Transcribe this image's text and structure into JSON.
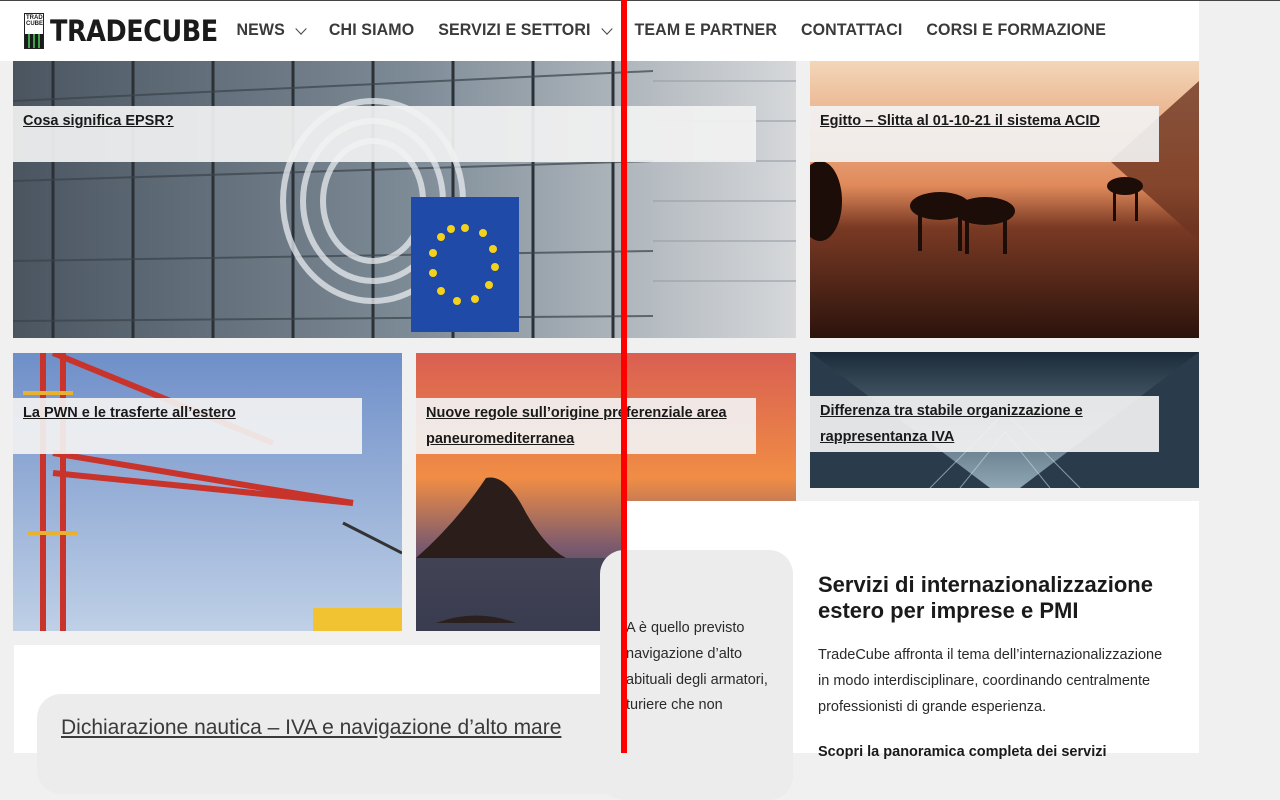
{
  "header": {
    "logo_small": "TRADE CUBE",
    "logo_text": "TRADECUBE",
    "nav": [
      {
        "label": "NEWS",
        "has_dropdown": true
      },
      {
        "label": "CHI SIAMO",
        "has_dropdown": false
      },
      {
        "label": "SERVIZI E SETTORI",
        "has_dropdown": true
      },
      {
        "label": "TEAM E PARTNER",
        "has_dropdown": false
      },
      {
        "label": "CONTATTACI",
        "has_dropdown": false
      },
      {
        "label": "CORSI E FORMAZIONE",
        "has_dropdown": false
      }
    ]
  },
  "cards": {
    "epsr": "Cosa significa EPSR?",
    "egitto": "Egitto – Slitta al 01-10-21 il sistema ACID",
    "pwn": "La PWN e le trasferte all’estero",
    "origine": "Nuove regole sull’origine preferenziale area paneuromediterranea",
    "stabile": "Differenza tra stabile organizzazione e rappresentanza IVA"
  },
  "article": {
    "title": "Dichiarazione nautica – IVA e navigazione d’alto mare",
    "lines": [
      "A è quello previsto",
      "navigazione d’alto",
      "abituali degli armatori,",
      "turiere che non"
    ]
  },
  "services": {
    "title": "Servizi di internazionalizzazione estero per imprese e PMI",
    "body": "TradeCube affronta il tema dell’internazionalizzazione in modo interdisciplinare, coordinando centralmente professionisti di grande esperienza.",
    "cta": "Scopri la panoramica completa dei servizi"
  },
  "colors": {
    "overlay_line": "#ff0000",
    "logo_green": "#3fa34d"
  }
}
